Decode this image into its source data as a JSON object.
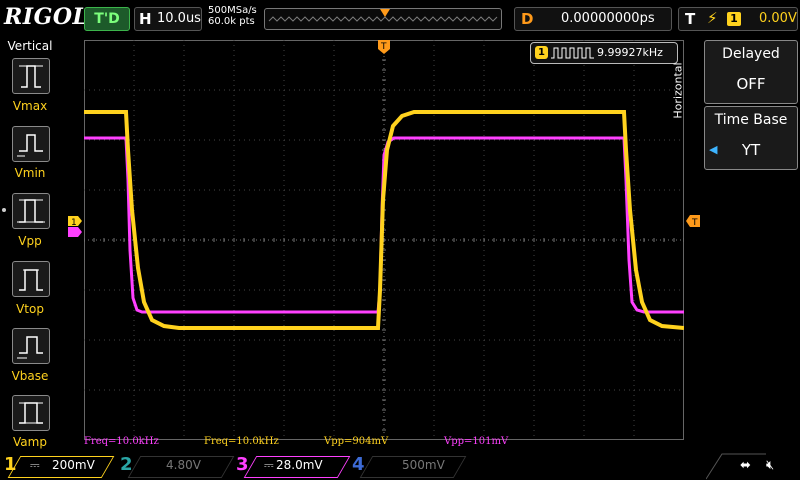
{
  "top": {
    "brand": "RIGOL",
    "trigger_status": "T'D",
    "horizontal_label": "H",
    "timebase": "10.0us",
    "sample_rate": "500MSa/s",
    "memory_depth": "60.0k pts",
    "delay_label": "D",
    "delay_value": "0.00000000ps",
    "trigger_label": "T",
    "trigger_source": "1",
    "trigger_level": "0.00V"
  },
  "left_menu": {
    "title": "Vertical",
    "items": [
      {
        "label": "Vmax",
        "icon": "vmax-icon"
      },
      {
        "label": "Vmin",
        "icon": "vmin-icon"
      },
      {
        "label": "Vpp",
        "icon": "vpp-icon"
      },
      {
        "label": "Vtop",
        "icon": "vtop-icon"
      },
      {
        "label": "Vbase",
        "icon": "vbase-icon"
      },
      {
        "label": "Vamp",
        "icon": "vamp-icon"
      }
    ]
  },
  "right_menu": {
    "tab": "Horizontal",
    "delayed_title": "Delayed",
    "delayed_value": "OFF",
    "timebase_title": "Time Base",
    "timebase_value": "YT"
  },
  "freq_counter": {
    "channel": "1",
    "value": "9.99927kHz"
  },
  "measurements": [
    {
      "text": "Freq=10.0kHz",
      "color": "#ff40ff"
    },
    {
      "text": "Freq=10.0kHz",
      "color": "#ffd21e"
    },
    {
      "text": "Vpp=904mV",
      "color": "#ffd21e"
    },
    {
      "text": "Vpp=101mV",
      "color": "#ff40ff"
    }
  ],
  "channels": [
    {
      "num": "1",
      "scale": "200mV",
      "color": "#ffd21e",
      "active": true
    },
    {
      "num": "2",
      "scale": "4.80V",
      "color": "#2aa6a6",
      "active": false
    },
    {
      "num": "3",
      "scale": "28.0mV",
      "color": "#ff40ff",
      "active": true
    },
    {
      "num": "4",
      "scale": "500mV",
      "color": "#3d6bd6",
      "active": false
    }
  ],
  "colors": {
    "ch1": "#ffd21e",
    "ch3": "#ff40ff",
    "trigger_marker": "#ff9a1a",
    "grid": "#555555"
  }
}
